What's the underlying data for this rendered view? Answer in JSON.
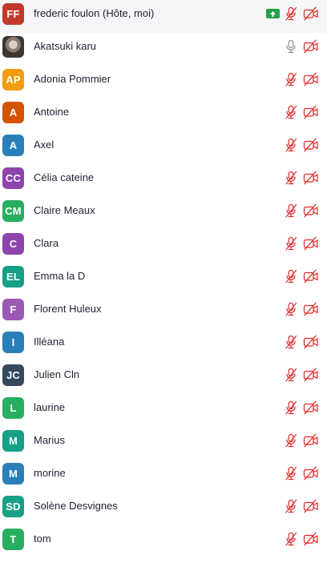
{
  "participants": [
    {
      "name": "frederic foulon (Hôte, moi)",
      "initials": "FF",
      "color": "#c0392b",
      "avatar": "initials",
      "mic": "muted",
      "cam": "off",
      "badge": "share-arrow-icon"
    },
    {
      "name": "Akatsuki karu",
      "initials": "",
      "color": "#6b5f55",
      "avatar": "photo",
      "mic": "on",
      "cam": "off"
    },
    {
      "name": "Adonia Pommier",
      "initials": "AP",
      "color": "#f39c12",
      "avatar": "initials",
      "mic": "muted",
      "cam": "off"
    },
    {
      "name": "Antoine",
      "initials": "A",
      "color": "#d35400",
      "avatar": "initials",
      "mic": "muted",
      "cam": "off"
    },
    {
      "name": "Axel",
      "initials": "A",
      "color": "#2980b9",
      "avatar": "initials",
      "mic": "muted",
      "cam": "off"
    },
    {
      "name": "Célia cateine",
      "initials": "CC",
      "color": "#8e44ad",
      "avatar": "initials",
      "mic": "muted",
      "cam": "off"
    },
    {
      "name": "Claire Meaux",
      "initials": "CM",
      "color": "#27ae60",
      "avatar": "initials",
      "mic": "muted",
      "cam": "off"
    },
    {
      "name": "Clara",
      "initials": "C",
      "color": "#8e44ad",
      "avatar": "initials",
      "mic": "muted",
      "cam": "off"
    },
    {
      "name": "Emma la D",
      "initials": "EL",
      "color": "#16a085",
      "avatar": "initials",
      "mic": "muted",
      "cam": "off"
    },
    {
      "name": "Florent Huleux",
      "initials": "F",
      "color": "#9b59b6",
      "avatar": "initials",
      "mic": "muted",
      "cam": "off"
    },
    {
      "name": "Illéana",
      "initials": "I",
      "color": "#2980b9",
      "avatar": "initials",
      "mic": "muted",
      "cam": "off"
    },
    {
      "name": "Julien Cln",
      "initials": "JC",
      "color": "#34495e",
      "avatar": "initials",
      "mic": "muted",
      "cam": "off"
    },
    {
      "name": "laurine",
      "initials": "L",
      "color": "#27ae60",
      "avatar": "initials",
      "mic": "muted",
      "cam": "off"
    },
    {
      "name": "Marius",
      "initials": "M",
      "color": "#16a085",
      "avatar": "initials",
      "mic": "muted",
      "cam": "off"
    },
    {
      "name": "morine",
      "initials": "M",
      "color": "#2980b9",
      "avatar": "initials",
      "mic": "muted",
      "cam": "off"
    },
    {
      "name": "Solène Desvignes",
      "initials": "SD",
      "color": "#16a085",
      "avatar": "initials",
      "mic": "muted",
      "cam": "off"
    },
    {
      "name": "tom",
      "initials": "T",
      "color": "#27ae60",
      "avatar": "initials",
      "mic": "muted",
      "cam": "off"
    }
  ],
  "colors": {
    "muted_icon": "#e02828",
    "mic_on_icon": "#8a8a8f",
    "share_badge": "#23a046",
    "name_text": "#232333"
  }
}
